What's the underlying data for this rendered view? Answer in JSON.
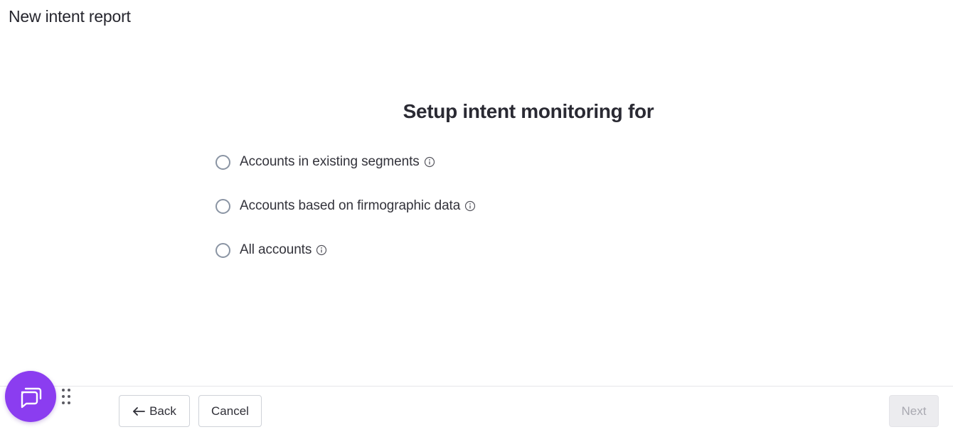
{
  "header": {
    "title": "New intent report"
  },
  "main": {
    "heading": "Setup intent monitoring for",
    "options": [
      {
        "label": "Accounts in existing segments",
        "selected": false,
        "icon": "info-icon"
      },
      {
        "label": "Accounts based on firmographic data",
        "selected": false,
        "icon": "info-icon"
      },
      {
        "label": "All accounts",
        "selected": false,
        "icon": "info-icon"
      }
    ]
  },
  "footer": {
    "back_label": "Back",
    "cancel_label": "Cancel",
    "next_label": "Next",
    "next_disabled": true
  },
  "widgets": {
    "chat_icon": "chat-bubble-icon",
    "chat_color": "#8b3df0",
    "drag_icon": "drag-handle-icon"
  }
}
